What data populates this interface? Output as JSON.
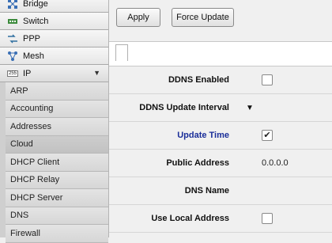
{
  "sidebar": {
    "items": [
      {
        "label": "Bridge",
        "icon": "bridge-icon"
      },
      {
        "label": "Switch",
        "icon": "switch-icon"
      },
      {
        "label": "PPP",
        "icon": "ppp-icon"
      },
      {
        "label": "Mesh",
        "icon": "mesh-icon"
      },
      {
        "label": "IP",
        "icon": "ip-icon",
        "icon_text": "255",
        "expanded_glyph": "▼"
      }
    ],
    "ip_submenu": [
      {
        "label": "ARP"
      },
      {
        "label": "Accounting"
      },
      {
        "label": "Addresses"
      },
      {
        "label": "Cloud",
        "selected": true
      },
      {
        "label": "DHCP Client"
      },
      {
        "label": "DHCP Relay"
      },
      {
        "label": "DHCP Server"
      },
      {
        "label": "DNS"
      },
      {
        "label": "Firewall"
      }
    ]
  },
  "toolbar": {
    "apply_label": "Apply",
    "force_update_label": "Force Update"
  },
  "form": {
    "ddns_enabled": {
      "label": "DDNS Enabled",
      "checked": false
    },
    "ddns_update_interval": {
      "label": "DDNS Update Interval",
      "glyph": "▼"
    },
    "update_time": {
      "label": "Update Time",
      "checked": true,
      "check_glyph": "✔"
    },
    "public_address": {
      "label": "Public Address",
      "value": "0.0.0.0"
    },
    "dns_name": {
      "label": "DNS Name",
      "value": ""
    },
    "use_local_address": {
      "label": "Use Local Address",
      "checked": false
    }
  },
  "colors": {
    "link_label": "#1a2e99",
    "sidebar_bg": "#cfcfcf",
    "panel_bg": "#f0f0f0"
  }
}
